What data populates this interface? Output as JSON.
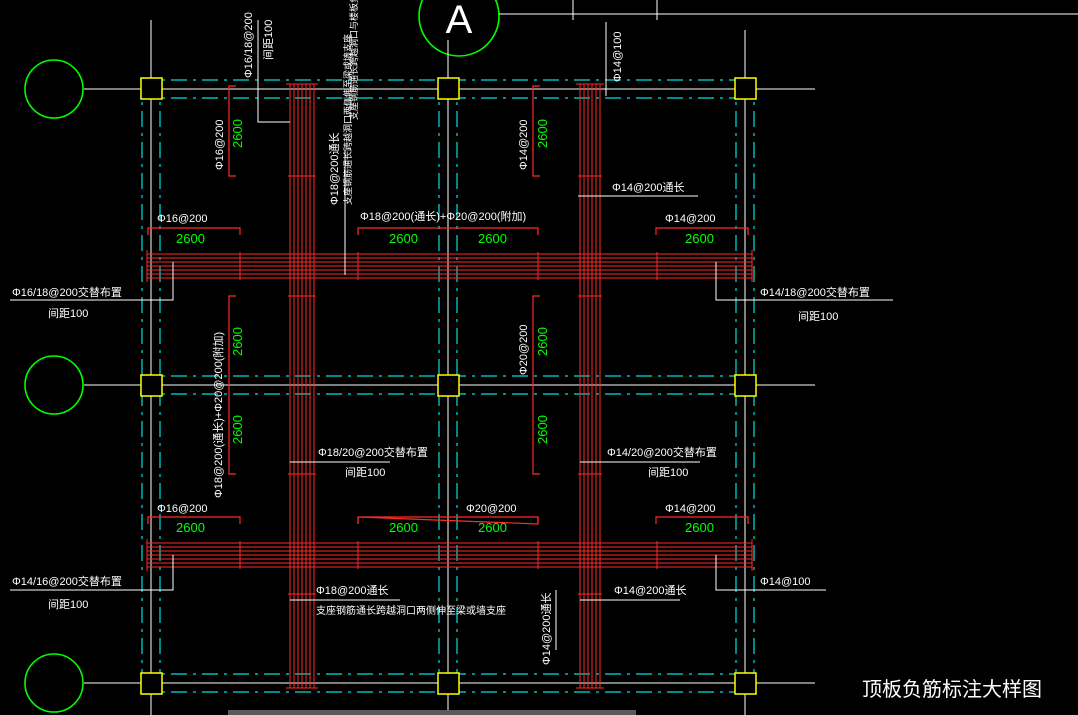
{
  "colors": {
    "background": "#000000",
    "axis_line": "#ffffff",
    "beam_dash": "#00e0e0",
    "rebar": "#ff2a2a",
    "dimension": "#00ff00",
    "axis_bubble": "#00ff00",
    "column": "#ffff00",
    "label": "#ffffff",
    "leader": "#ffffff"
  },
  "title": "顶板负筋标注大样图",
  "axis_label": "A",
  "dims": {
    "d2600": "2600"
  },
  "labels": {
    "top_left_vertical": "Φ16/18@200",
    "top_left_spacing": "间距100",
    "top_right_vertical": "Φ14@100",
    "col1_rebar_top": "Φ16@200",
    "col3_rebar_top": "Φ14@200",
    "col2_through": "Φ18@200通长",
    "col2_through_note": "支座钢筋通长跨越洞口与楼板负筋支座",
    "col2_through_note2": "支座钢筋通长跨越洞口两侧伸至梁或墙支座",
    "r1_left": "Φ16@200",
    "r1_mid": "Φ18@200(通长)+Φ20@200(附加)",
    "r1_right": "Φ14@200",
    "r1_right_through": "Φ14@200通长",
    "left_mid1": "Φ16/18@200交替布置",
    "left_mid1_spacing": "间距100",
    "right_mid1": "Φ14/18@200交替布置",
    "right_mid1_spacing": "间距100",
    "col1_mid": "Φ18@200(通长)+Φ20@200(附加)",
    "col3_mid": "Φ20@200",
    "center_mid": "Φ18/20@200交替布置",
    "center_mid_spacing": "间距100",
    "right_center": "Φ14/20@200交替布置",
    "right_center_spacing": "间距100",
    "r2_left": "Φ16@200",
    "r2_mid": "Φ20@200",
    "r2_right": "Φ14@200",
    "left_bot": "Φ14/16@200交替布置",
    "left_bot_spacing": "间距100",
    "bot_through": "Φ18@200通长",
    "bot_through_note": "支座钢筋通长跨越洞口两侧伸至梁或墙支座",
    "bot_right_through": "Φ14@200通长",
    "bot_right": "Φ14@100",
    "bot_col3": "Φ14@200通长"
  }
}
